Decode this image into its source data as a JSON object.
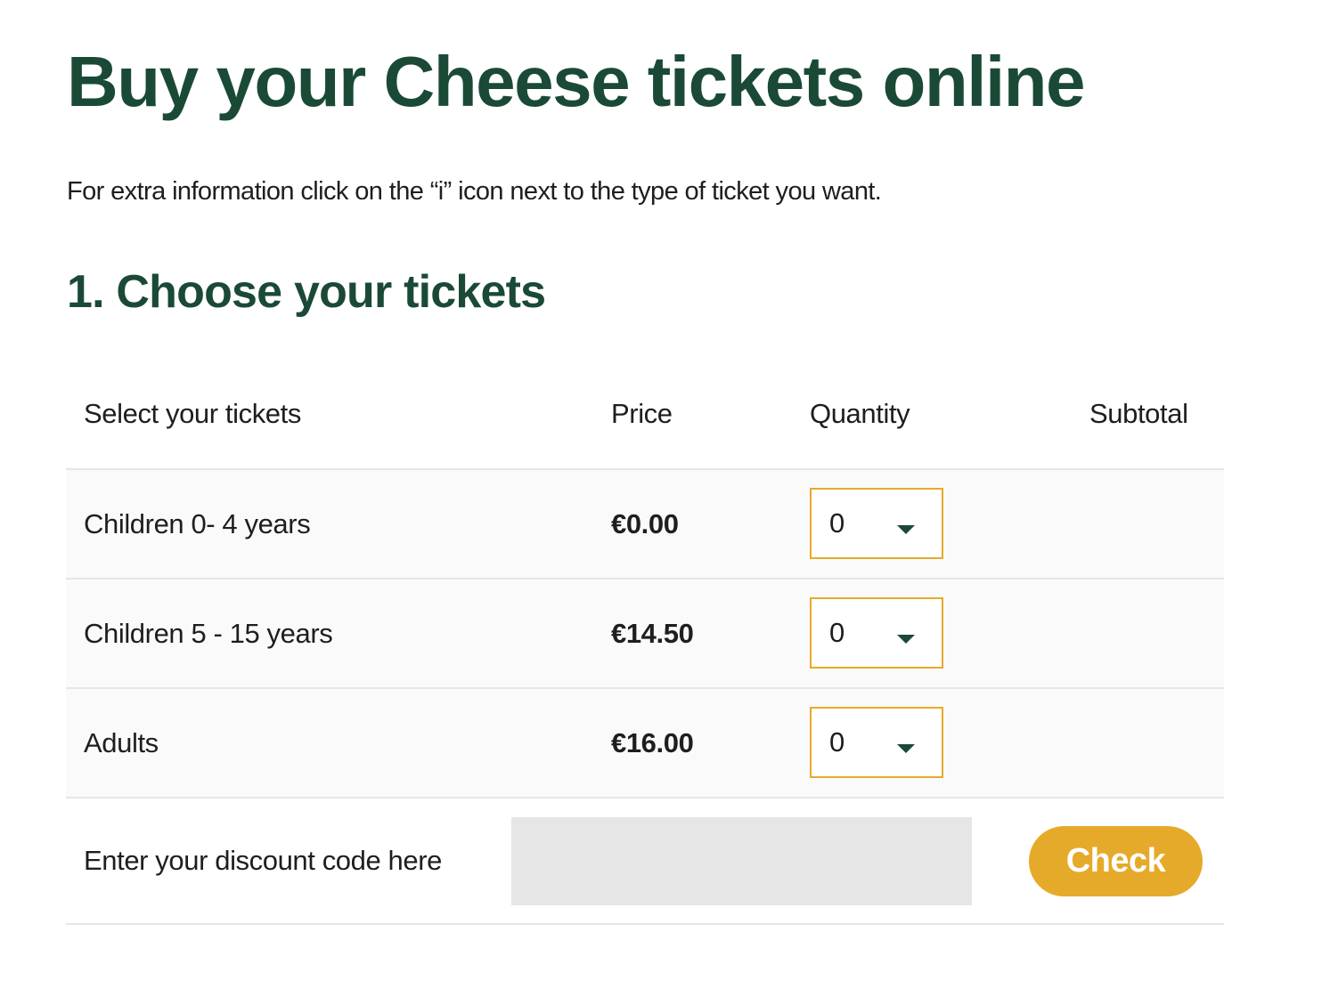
{
  "page": {
    "title": "Buy your Cheese tickets online",
    "intro": "For extra information click on the “i” icon next to the type of ticket you want.",
    "section_heading": "1. Choose your tickets"
  },
  "table": {
    "headers": {
      "name": "Select your tickets",
      "price": "Price",
      "quantity": "Quantity",
      "subtotal": "Subtotal"
    },
    "rows": [
      {
        "name": "Children 0- 4 years",
        "price": "€0.00",
        "quantity": "0"
      },
      {
        "name": "Children 5 - 15 years",
        "price": "€14.50",
        "quantity": "0"
      },
      {
        "name": "Adults",
        "price": "€16.00",
        "quantity": "0"
      }
    ]
  },
  "discount": {
    "label": "Enter your discount code here",
    "value": "",
    "button_label": "Check"
  },
  "colors": {
    "heading_green": "#1a4a36",
    "accent_yellow": "#e6aa2a",
    "row_background": "#fafafa",
    "input_background": "#e6e6e6"
  },
  "icons": {
    "quantity_dropdown": "chevron-down-icon"
  }
}
